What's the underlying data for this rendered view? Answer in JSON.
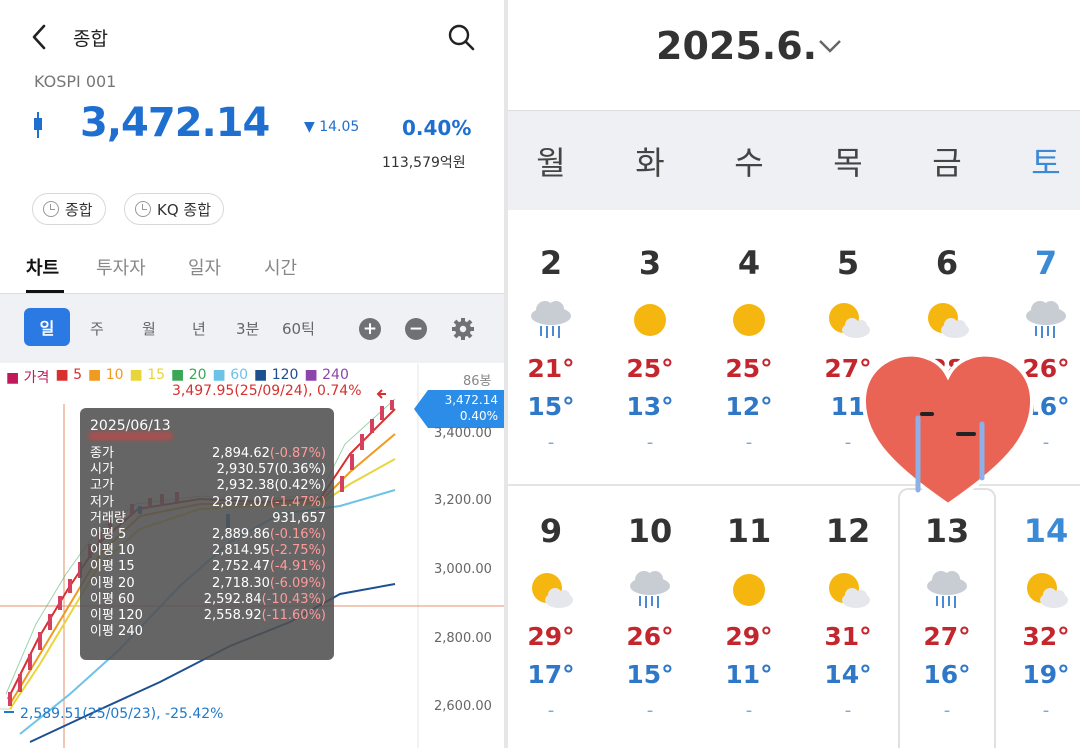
{
  "stock": {
    "header_title": "종합",
    "code": "KOSPI 001",
    "price": "3,472.14",
    "change": "▼ 14.05",
    "change_pct": "0.40%",
    "volume": "113,579억원",
    "chips": [
      "종합",
      "KQ 종합"
    ],
    "tabs": [
      "차트",
      "투자자",
      "일자",
      "시간"
    ],
    "periods": [
      "일",
      "주",
      "월",
      "년",
      "3분",
      "60틱"
    ],
    "legend": [
      {
        "label": "■ 가격",
        "color": "#c2185b"
      },
      {
        "label": "■ 5",
        "color": "#d6302f"
      },
      {
        "label": "■ 10",
        "color": "#f09a1f"
      },
      {
        "label": "■ 15",
        "color": "#e8d53a"
      },
      {
        "label": "■ 20",
        "color": "#3aa757"
      },
      {
        "label": "■ 60",
        "color": "#6cc3e8"
      },
      {
        "label": "■ 120",
        "color": "#1d4f91"
      },
      {
        "label": "■ 240",
        "color": "#8e44ad"
      }
    ],
    "bars_count": "86봉",
    "max_label": "3,497.95(25/09/24), 0.74%",
    "min_label": "2,589.51(25/05/23), -25.42%",
    "price_tag_value": "3,472.14",
    "price_tag_pct": "0.40%",
    "y_axis": [
      "3,400.00",
      "3,200.00",
      "3,000.00",
      "2,800.00",
      "2,600.00"
    ],
    "tooltip": {
      "date": "2025/06/13",
      "rows": [
        {
          "label": "종가",
          "value": "2,894.62",
          "extra": "(-0.87%)"
        },
        {
          "label": "시가",
          "value": "2,930.57",
          "extra": "(0.36%)"
        },
        {
          "label": "고가",
          "value": "2,932.38",
          "extra": "(0.42%)"
        },
        {
          "label": "저가",
          "value": "2,877.07",
          "extra": "(-1.47%)"
        },
        {
          "label": "거래량",
          "value": "931,657",
          "extra": ""
        },
        {
          "label": "이평 5",
          "value": "2,889.86",
          "extra": "(-0.16%)"
        },
        {
          "label": "이평 10",
          "value": "2,814.95",
          "extra": "(-2.75%)"
        },
        {
          "label": "이평 15",
          "value": "2,752.47",
          "extra": "(-4.91%)"
        },
        {
          "label": "이평 20",
          "value": "2,718.30",
          "extra": "(-6.09%)"
        },
        {
          "label": "이평 60",
          "value": "2,592.84",
          "extra": "(-10.43%)"
        },
        {
          "label": "이평 120",
          "value": "2,558.92",
          "extra": "(-11.60%)"
        },
        {
          "label": "이평 240",
          "value": "",
          "extra": ""
        }
      ]
    }
  },
  "calendar": {
    "title": "2025.6.",
    "weekdays": [
      "월",
      "화",
      "수",
      "목",
      "금",
      "토"
    ],
    "saturday_color": "#3b8ad6",
    "week1": [
      {
        "day": "2",
        "icon": "rain-icon",
        "hi": "21°",
        "lo": "15°",
        "mark": "-"
      },
      {
        "day": "3",
        "icon": "sun-icon",
        "hi": "25°",
        "lo": "13°",
        "mark": "-"
      },
      {
        "day": "4",
        "icon": "sun-icon",
        "hi": "25°",
        "lo": "12°",
        "mark": "-"
      },
      {
        "day": "5",
        "icon": "partly-cloudy-icon",
        "hi": "27°",
        "lo": "11",
        "mark": "-"
      },
      {
        "day": "6",
        "icon": "partly-cloudy-icon",
        "hi": "28",
        "lo": "",
        "mark": ""
      },
      {
        "day": "7",
        "icon": "rain-icon",
        "hi": "26°",
        "lo": "16°",
        "mark": "-"
      }
    ],
    "week2": [
      {
        "day": "9",
        "icon": "partly-cloudy-icon",
        "hi": "29°",
        "lo": "17°",
        "mark": "-"
      },
      {
        "day": "10",
        "icon": "rain-icon",
        "hi": "26°",
        "lo": "15°",
        "mark": "-"
      },
      {
        "day": "11",
        "icon": "sun-icon",
        "hi": "29°",
        "lo": "11°",
        "mark": "-"
      },
      {
        "day": "12",
        "icon": "partly-cloudy-icon",
        "hi": "31°",
        "lo": "14°",
        "mark": "-"
      },
      {
        "day": "13",
        "icon": "rain-icon",
        "hi": "27°",
        "lo": "16°",
        "mark": "-"
      },
      {
        "day": "14",
        "icon": "partly-cloudy-icon",
        "hi": "32°",
        "lo": "19°",
        "mark": "-"
      }
    ]
  }
}
